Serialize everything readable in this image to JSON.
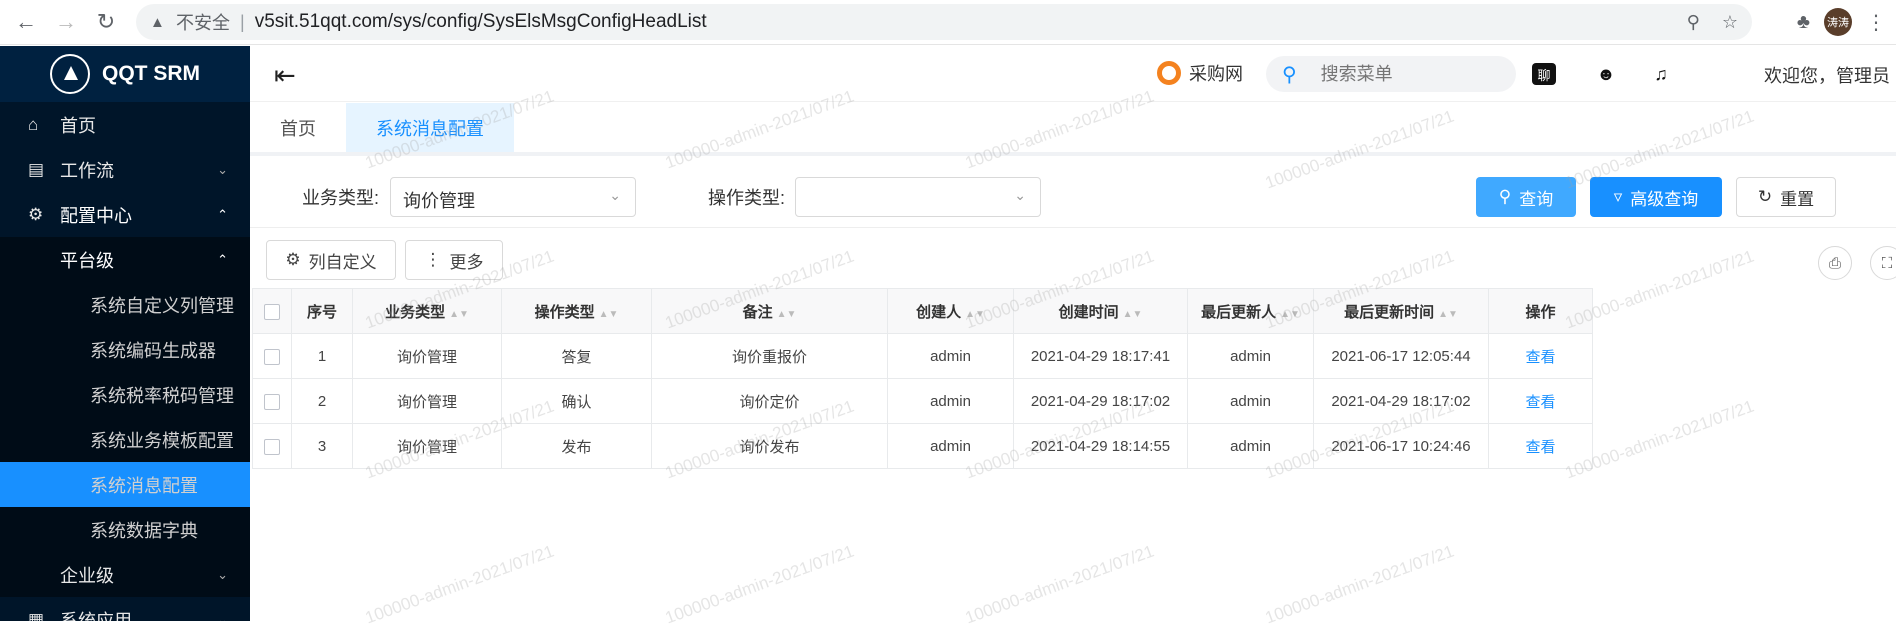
{
  "browser": {
    "insecure_label": "不安全",
    "url": "v5sit.51qqt.com/sys/config/SysElsMsgConfigHeadList",
    "avatar_text": "涛涛"
  },
  "sidebar": {
    "brand": "QQT SRM",
    "items": [
      {
        "label": "首页",
        "icon": "home-icon"
      },
      {
        "label": "工作流",
        "icon": "workflow-icon"
      },
      {
        "label": "配置中心",
        "icon": "gear-icon"
      },
      {
        "label": "平台级"
      },
      {
        "label": "系统自定义列管理"
      },
      {
        "label": "系统编码生成器"
      },
      {
        "label": "系统税率税码管理"
      },
      {
        "label": "系统业务模板配置"
      },
      {
        "label": "系统消息配置"
      },
      {
        "label": "系统数据字典"
      },
      {
        "label": "企业级"
      },
      {
        "label": "系统应用"
      }
    ]
  },
  "topbar": {
    "brand_name": "采购网",
    "search_placeholder": "搜索菜单",
    "chat_icon_text": "聊",
    "welcome": "欢迎您，管理员"
  },
  "tabs": [
    {
      "label": "首页"
    },
    {
      "label": "系统消息配置"
    }
  ],
  "filter": {
    "business_type_label": "业务类型:",
    "business_type_value": "询价管理",
    "operation_type_label": "操作类型:",
    "operation_type_value": "",
    "query_label": "查询",
    "advanced_query_label": "高级查询",
    "reset_label": "重置"
  },
  "toolbar": {
    "column_custom_label": "列自定义",
    "more_label": "更多"
  },
  "table": {
    "columns": [
      "序号",
      "业务类型",
      "操作类型",
      "备注",
      "创建人",
      "创建时间",
      "最后更新人",
      "最后更新时间",
      "操作"
    ],
    "rows": [
      [
        "1",
        "询价管理",
        "答复",
        "询价重报价",
        "admin",
        "2021-04-29 18:17:41",
        "admin",
        "2021-06-17 12:05:44",
        "查看"
      ],
      [
        "2",
        "询价管理",
        "确认",
        "询价定价",
        "admin",
        "2021-04-29 18:17:02",
        "admin",
        "2021-04-29 18:17:02",
        "查看"
      ],
      [
        "3",
        "询价管理",
        "发布",
        "询价发布",
        "admin",
        "2021-04-29 18:14:55",
        "admin",
        "2021-06-17 10:24:46",
        "查看"
      ]
    ]
  },
  "watermark": "100000-admin-2021/07/21",
  "colors": {
    "primary": "#1890ff",
    "sidebar_bg": "#001529",
    "active_tab_bg": "#e6f4ff"
  }
}
